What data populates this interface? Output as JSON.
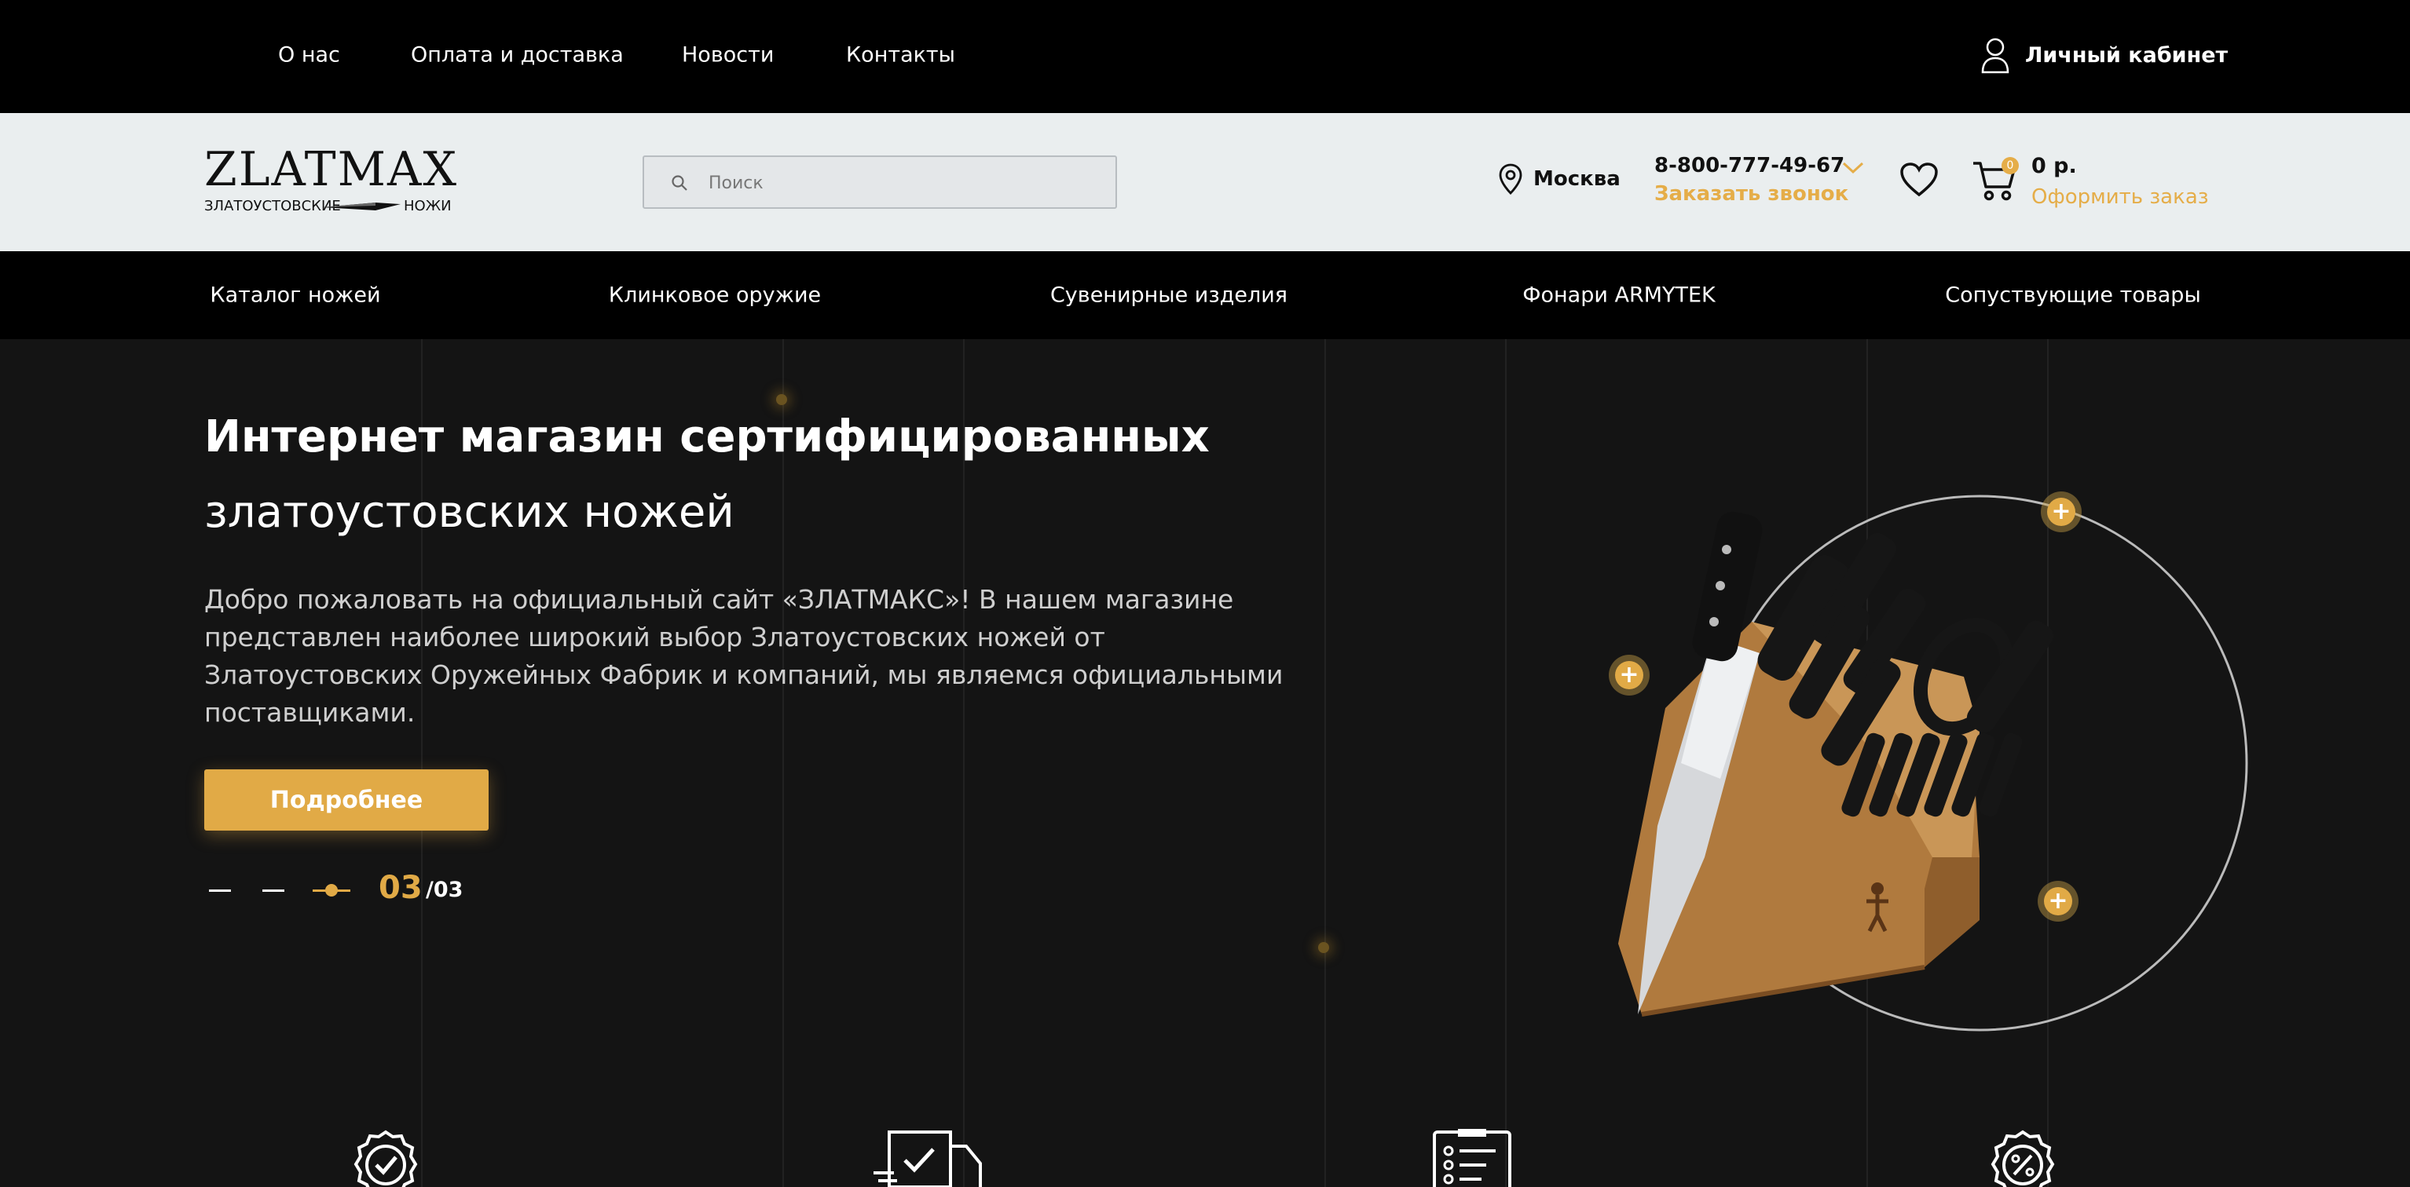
{
  "topbar": {
    "links": [
      "О нас",
      "Оплата и доставка",
      "Новости",
      "Контакты"
    ],
    "account_label": "Личный кабинет"
  },
  "header": {
    "logo": {
      "word": "ZLATMAX",
      "sub_left": "ЗЛАТОУСТОВСКИЕ",
      "sub_right": "НОЖИ"
    },
    "search_placeholder": "Поиск",
    "city": "Москва",
    "phone": "8-800-777-49-67",
    "callback_label": "Заказать звонок",
    "cart": {
      "count": "0",
      "total": "0 р.",
      "order_label": "Оформить заказ"
    }
  },
  "nav": {
    "items": [
      "Каталог ножей",
      "Клинковое оружие",
      "Сувенирные изделия",
      "Фонари ARMYTEK",
      "Сопуствующие товары"
    ]
  },
  "hero": {
    "title_line1": "Интернет магазин сертифицированных",
    "title_line2": "златоустовских ножей",
    "description": "Добро пожаловать на официальный сайт «ЗЛАТМАКС»! В нашем магазине представлен наиболее широкий выбор Златоустовских ножей от Златоустовских Оружейных Фабрик и компаний, мы являемся официальными поставщиками.",
    "button_label": "Подробнее",
    "slider": {
      "current": "03",
      "total": "/03"
    }
  },
  "colors": {
    "accent": "#e1aa46",
    "dark": "#000000",
    "header_bg": "#eaeeef",
    "hero_bg": "#141414"
  },
  "icons": [
    "user-icon",
    "map-pin-icon",
    "chevron-down-icon",
    "heart-icon",
    "cart-icon",
    "search-icon",
    "certificate-check-icon",
    "delivery-truck-icon",
    "checklist-icon",
    "discount-badge-icon"
  ]
}
